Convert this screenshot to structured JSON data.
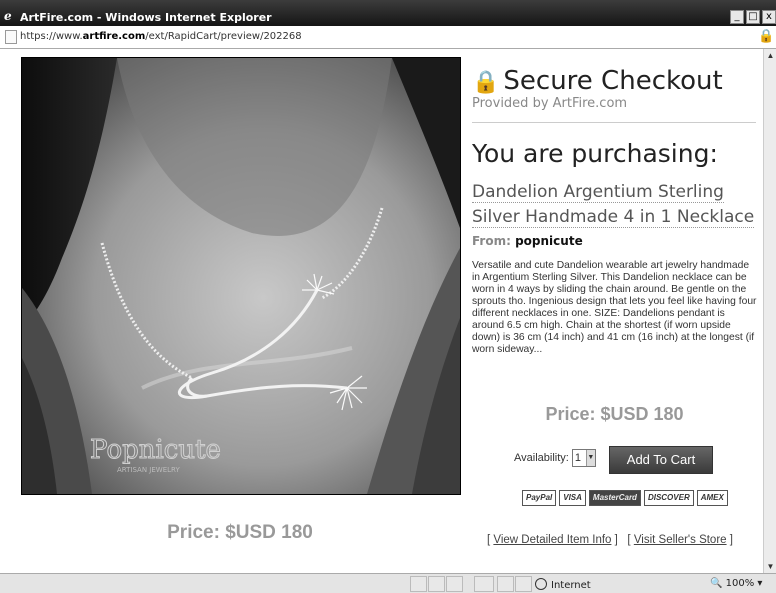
{
  "window": {
    "title": "ArtFire.com - Windows Internet Explorer",
    "url_prefix": "https://www.",
    "url_domain": "artfire.com",
    "url_path": "/ext/RapidCart/preview/202268"
  },
  "image": {
    "watermark_text": "Popnicute",
    "watermark_sub": "ARTISAN JEWELRY"
  },
  "left": {
    "price": "Price: $USD 180"
  },
  "checkout": {
    "heading": "Secure Checkout",
    "provided_by": "Provided by ArtFire.com",
    "purchasing_label": "You are purchasing:",
    "product_title_line1": "Dandelion Argentium Sterling",
    "product_title_line2": "Silver Handmade 4 in 1 Necklace",
    "from_label": "From:",
    "seller": "popnicute",
    "description": "Versatile and cute Dandelion wearable art jewelry handmade in Argentium Sterling Silver. This Dandelion necklace can be worn in 4 ways by sliding the chain around. Be gentle on the sprouts tho. Ingenious design that lets you feel like having four different necklaces in one. SIZE: Dandelions pendant is around 6.5 cm high. Chain at the shortest (if worn upside down) is 36 cm (14 inch) and 41 cm (16 inch) at the longest (if worn sideway...",
    "price": "Price: $USD 180",
    "availability_label": "Availability:",
    "availability_value": "1",
    "add_to_cart": "Add To Cart",
    "payment_cards": [
      "PayPal",
      "VISA",
      "MasterCard",
      "DISCOVER",
      "AMEX"
    ],
    "link_details": "View Detailed Item Info",
    "link_store": "Visit Seller's Store"
  },
  "status": {
    "zone": "Internet",
    "zoom": "100%"
  }
}
